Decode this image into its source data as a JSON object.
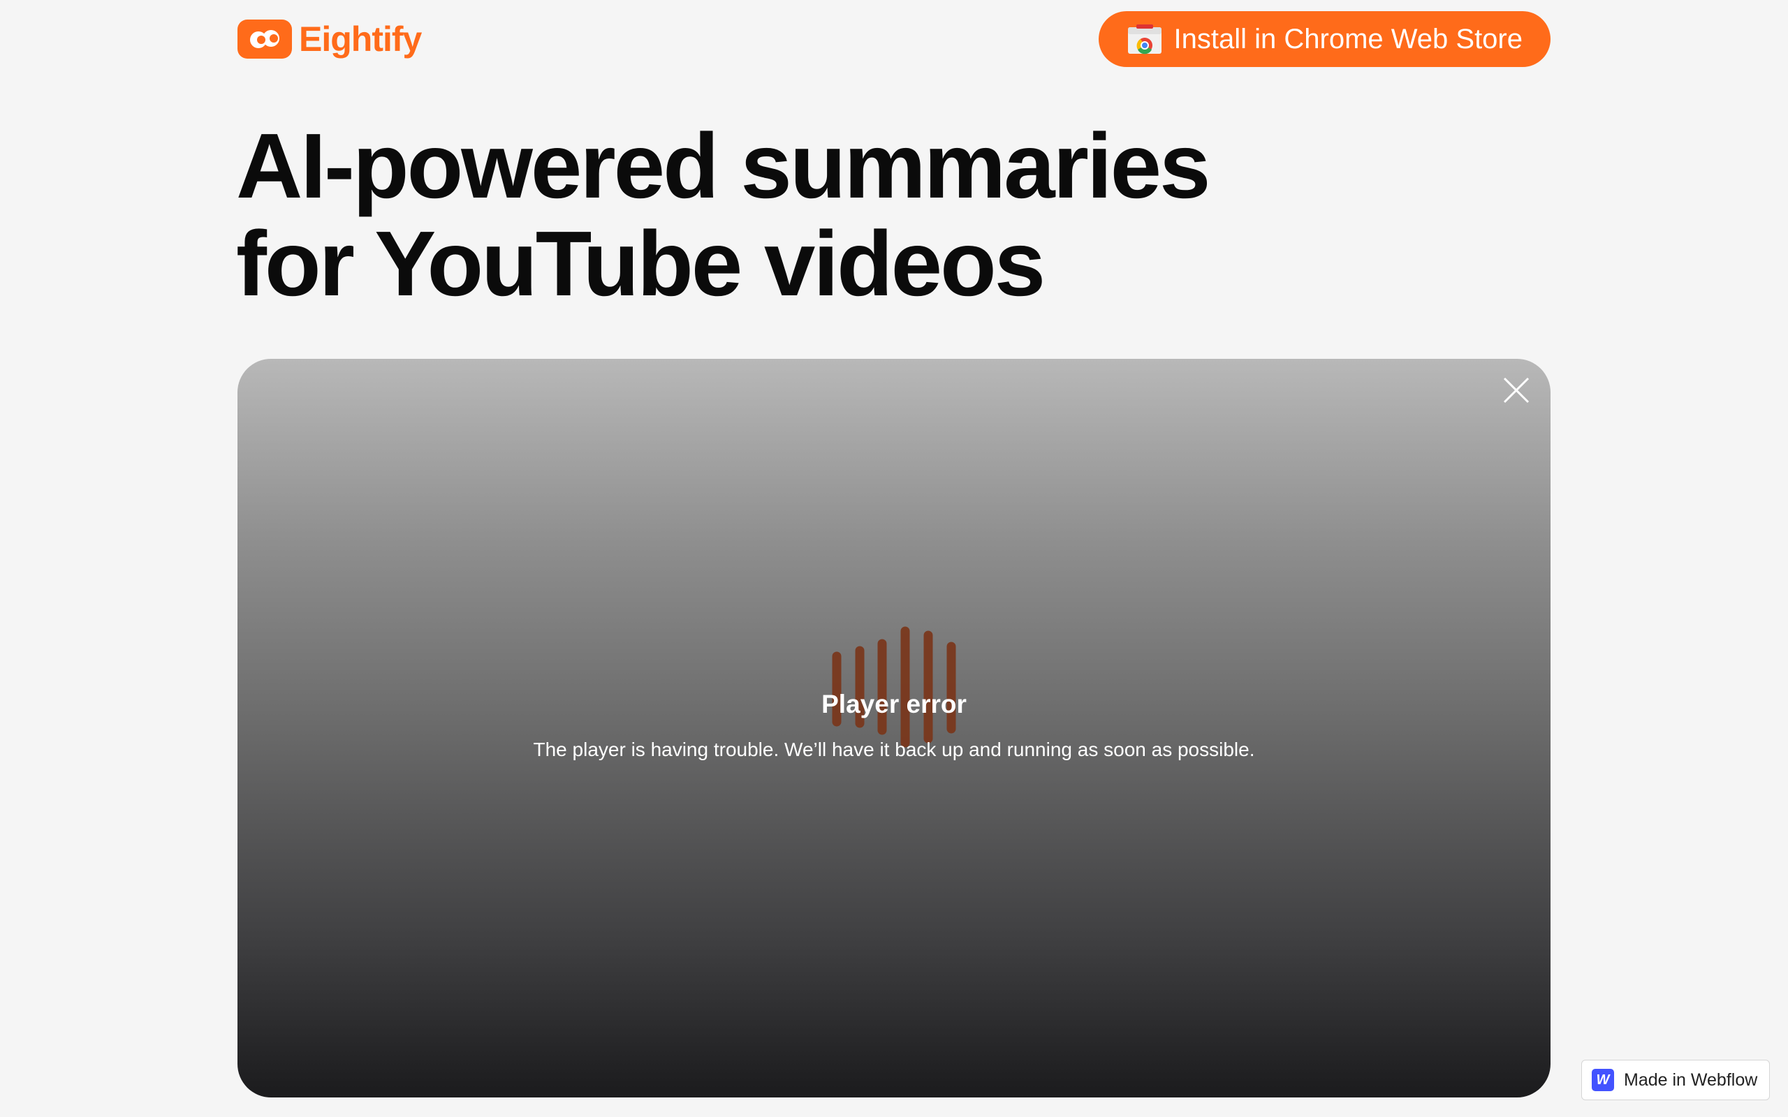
{
  "brand": {
    "name": "Eightify",
    "accent_color": "#ff6b1a",
    "logo_icon": "eightify-logo-icon"
  },
  "header": {
    "install_label": "Install in Chrome Web Store",
    "install_icon": "chrome-web-store-icon"
  },
  "hero": {
    "line1": "AI-powered summaries",
    "line2": "for YouTube videos"
  },
  "player": {
    "error_title": "Player error",
    "error_message": "The player is having trouble. We’ll have it back up and running as soon as possible.",
    "close_icon": "close-icon",
    "loader_bar_color": "#7a3519"
  },
  "badge": {
    "label": "Made in Webflow",
    "icon_letter": "W"
  }
}
